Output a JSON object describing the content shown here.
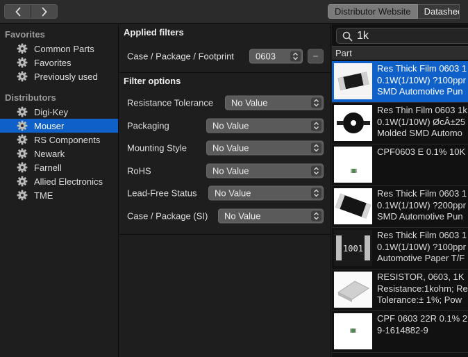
{
  "toolbar": {
    "back_icon": "chevron-left-icon",
    "forward_icon": "chevron-right-icon",
    "tabs": [
      {
        "label": "Distributor Website",
        "active": true
      },
      {
        "label": "Datasheet",
        "active": false
      }
    ]
  },
  "sidebar": {
    "favorites_heading": "Favorites",
    "favorites": [
      {
        "label": "Common Parts"
      },
      {
        "label": "Favorites"
      },
      {
        "label": "Previously used"
      }
    ],
    "distributors_heading": "Distributors",
    "distributors": [
      {
        "label": "Digi-Key"
      },
      {
        "label": "Mouser",
        "selected": true
      },
      {
        "label": "RS Components"
      },
      {
        "label": "Newark"
      },
      {
        "label": "Farnell"
      },
      {
        "label": "Allied Electronics"
      },
      {
        "label": "TME"
      }
    ]
  },
  "filters": {
    "applied_title": "Applied filters",
    "applied": [
      {
        "label": "Case / Package / Footprint",
        "value": "0603"
      }
    ],
    "options_title": "Filter options",
    "options": [
      {
        "label": "Resistance Tolerance",
        "value": "No Value"
      },
      {
        "label": "Packaging",
        "value": "No Value"
      },
      {
        "label": "Mounting Style",
        "value": "No Value"
      },
      {
        "label": "RoHS",
        "value": "No Value"
      },
      {
        "label": "Lead-Free Status",
        "value": "No Value"
      },
      {
        "label": "Case / Package (SI)",
        "value": "No Value"
      }
    ]
  },
  "results": {
    "search_value": "1k",
    "column_header": "Part",
    "rows": [
      {
        "lines": [
          "Res Thick Film 0603 1",
          "0.1W(1/10W) ?100ppr",
          "SMD Automotive Pun"
        ],
        "selected": true,
        "thumb": "chip-resistor"
      },
      {
        "lines": [
          "Res Thin Film 0603 1k",
          "0.1W(1/10W) ØcÂ±25",
          "Molded SMD Automo"
        ],
        "selected": false,
        "thumb": "reel"
      },
      {
        "lines": [
          "CPF0603 E 0.1% 10K"
        ],
        "selected": false,
        "thumb": "tiny-part"
      },
      {
        "lines": [
          "Res Thick Film 0603 1",
          "0.1W(1/10W) ?200ppr",
          "SMD Automotive Pun"
        ],
        "selected": false,
        "thumb": "chip-resistor-angled"
      },
      {
        "lines": [
          "Res Thick Film 0603 1",
          "0.1W(1/10W) ?100ppr",
          "Automotive Paper T/F"
        ],
        "selected": false,
        "thumb": "marked-resistor",
        "thumb_marking": "1001"
      },
      {
        "lines": [
          "RESISTOR, 0603, 1K",
          "Resistance:1kohm; Re",
          "Tolerance:± 1%; Pow"
        ],
        "selected": false,
        "thumb": "chip-resistor-gray"
      },
      {
        "lines": [
          "CPF 0603 22R 0.1% 2",
          "9-1614882-9"
        ],
        "selected": false,
        "thumb": "tiny-part"
      }
    ]
  },
  "colors": {
    "selection": "#0f60c8",
    "background": "#1e1e1e",
    "results_background": "#111111"
  }
}
